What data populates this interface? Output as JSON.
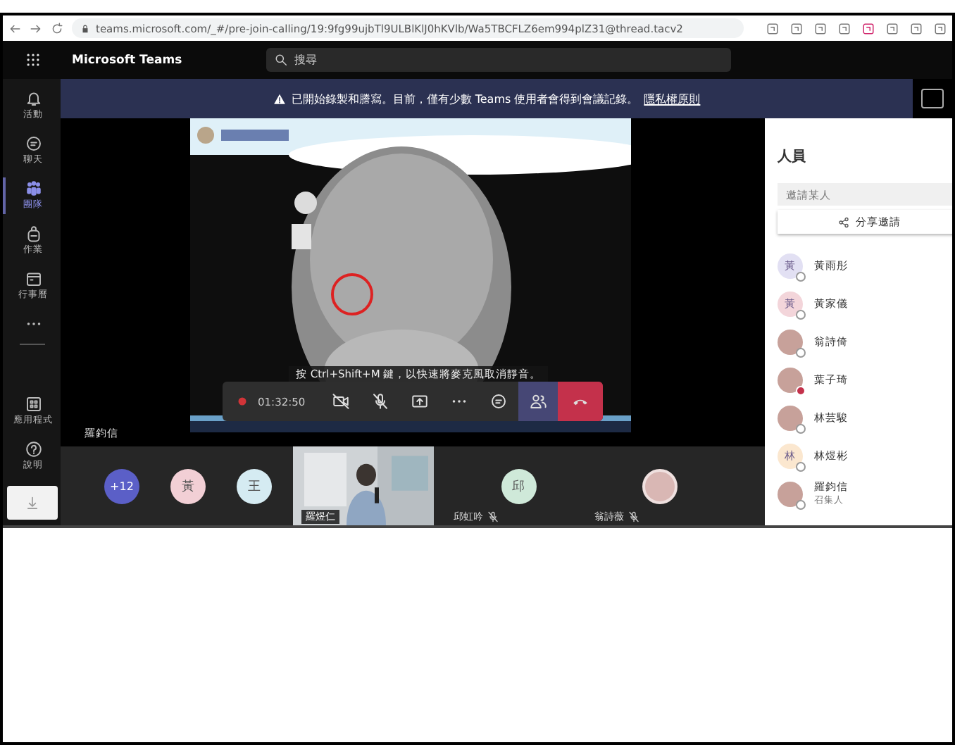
{
  "browser": {
    "url": "teams.microsoft.com/_#/pre-join-calling/19:9fg99ujbTl9ULBlKlJ0hKVlb/Wa5TBCFLZ6em994plZ31@thread.tacv2"
  },
  "app": {
    "title": "Microsoft Teams",
    "search": {
      "placeholder": "搜尋"
    }
  },
  "rail": [
    {
      "label": "活動",
      "selected": false
    },
    {
      "label": "聊天",
      "selected": false
    },
    {
      "label": "團隊",
      "selected": true
    },
    {
      "label": "作業",
      "selected": false
    },
    {
      "label": "行事曆",
      "selected": false
    },
    {
      "selected": false
    }
  ],
  "rail_bottom": [
    {
      "label": "應用程式"
    },
    {
      "label": "說明"
    }
  ],
  "banner": {
    "text": "已開始錄製和謄寫。目前，僅有少數 Teams 使用者會得到會議記錄。",
    "link": "隱私權原則"
  },
  "stage": {
    "presenter": "羅鈞信",
    "caption": "按 Ctrl+Shift+M 鍵，以快速將麥克風取消靜音。"
  },
  "controls": {
    "recording": true,
    "timer": "01:32:50",
    "camera_on": false,
    "mic_on": false,
    "people_selected": true
  },
  "gallery": [
    {
      "kind": "count",
      "label": "+12"
    },
    {
      "kind": "initial",
      "label": "黃",
      "color": "#f2cfd5"
    },
    {
      "kind": "initial",
      "label": "王",
      "color": "#d5ebf2"
    },
    {
      "kind": "video",
      "name": "羅煜仁"
    },
    {
      "kind": "initial",
      "label": "邱",
      "color": "#cfe9d9",
      "name": "邱虹吟",
      "muted": true
    },
    {
      "name": "翁詩薇",
      "muted": true
    }
  ],
  "people": {
    "title": "人員",
    "invite": {
      "placeholder": "邀請某人"
    },
    "share": "分享邀請",
    "members": [
      {
        "kind": "initial",
        "initial": "黃",
        "name": "黃雨彤",
        "color": "#e2e0f3",
        "busy": false
      },
      {
        "kind": "initial",
        "initial": "黃",
        "name": "黃家儀",
        "color": "#f3d5da",
        "busy": false
      },
      {
        "name": "翁詩倚",
        "busy": false
      },
      {
        "name": "葉子琦",
        "busy": true
      },
      {
        "name": "林芸駿",
        "busy": false
      },
      {
        "kind": "initial",
        "initial": "林",
        "name": "林煜彬",
        "color": "#fbe7cf",
        "busy": false
      },
      {
        "name": "羅鈞信",
        "role": "召集人",
        "busy": false
      }
    ]
  }
}
